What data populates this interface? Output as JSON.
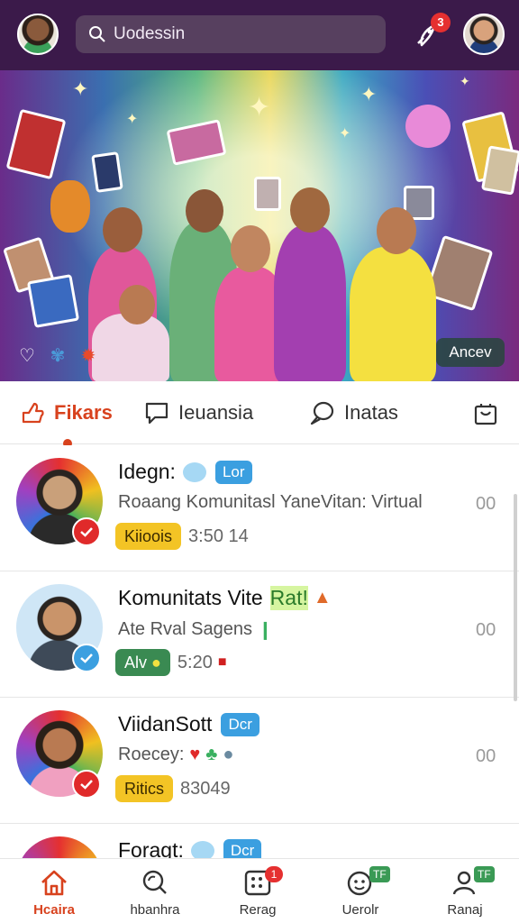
{
  "header": {
    "search_text": "Uodessin",
    "notification_count": "3"
  },
  "hero": {
    "button_label": "Ancev",
    "icons": [
      "heart-outline-icon",
      "puzzle-icon",
      "flower-icon"
    ]
  },
  "tabs": [
    {
      "label": "Fikars",
      "icon": "hand-icon",
      "active": true
    },
    {
      "label": "Ieuansia",
      "icon": "chat-bubble-icon",
      "active": false
    },
    {
      "label": "Inatas",
      "icon": "speech-icon",
      "active": false
    }
  ],
  "feed": [
    {
      "title": "Idegn:",
      "tag": "Lor",
      "subtitle": "Roaang Komunitasl YaneVitan: Virtual",
      "count": "00",
      "pill": "Kiioois",
      "pill_color": "yellow",
      "time": "3:50 14",
      "verified_color": "#e02a2a"
    },
    {
      "title": "Komunitats Vite",
      "title_extra": "Rat!",
      "tag": "",
      "subtitle": "Ate Rval Sagens",
      "count": "00",
      "pill": "Alv",
      "pill_color": "green",
      "time": "5:20",
      "verified_color": "#3b9fe0"
    },
    {
      "title": "ViidanSott",
      "tag": "Dcr",
      "subtitle": "Roecey:",
      "count": "00",
      "pill": "Ritics",
      "pill_color": "yellow",
      "time": "83049",
      "verified_color": "#e02a2a"
    },
    {
      "title": "Foragt:",
      "tag": "Dcr",
      "subtitle": "",
      "count": "",
      "pill": "",
      "pill_color": "",
      "time": "",
      "verified_color": ""
    }
  ],
  "bottom_nav": [
    {
      "label": "Hcaira",
      "icon": "home-icon",
      "active": true,
      "badge": ""
    },
    {
      "label": "hbanhra",
      "icon": "search-icon",
      "active": false,
      "badge": ""
    },
    {
      "label": "Rerag",
      "icon": "grid-icon",
      "active": false,
      "badge": "1"
    },
    {
      "label": "Uerolr",
      "icon": "face-icon",
      "active": false,
      "badge": "TF"
    },
    {
      "label": "Ranaj",
      "icon": "user-icon",
      "active": false,
      "badge": "TF"
    }
  ],
  "colors": {
    "topbar": "#3b1a4a",
    "accent": "#d8421e",
    "tag_blue": "#3b9fe0",
    "pill_yellow": "#f3c425",
    "pill_green": "#3a8a52"
  }
}
